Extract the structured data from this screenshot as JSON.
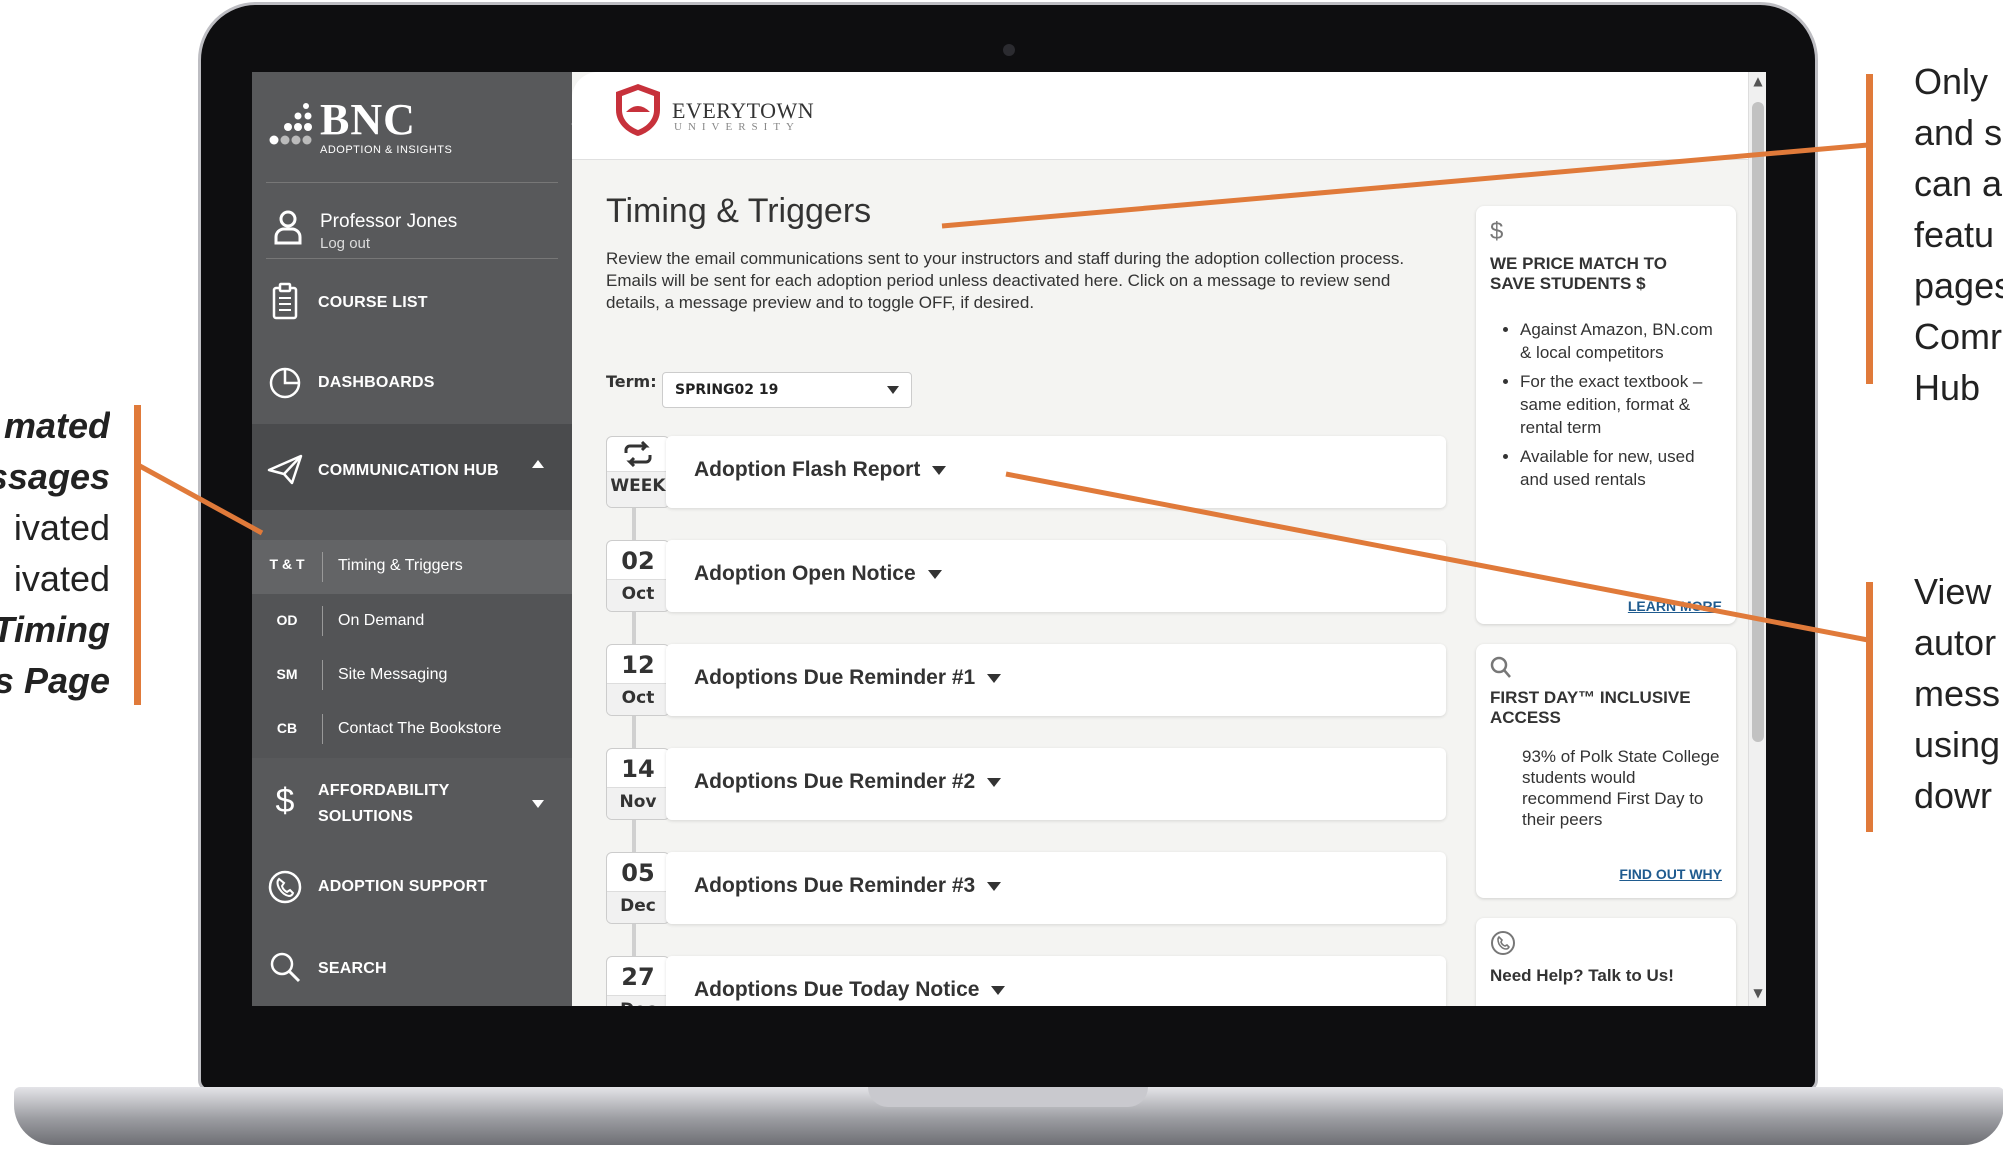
{
  "sidebar": {
    "logo_text": "BNC",
    "logo_sub": "ADOPTION & INSIGHTS",
    "collapse_icon": "chevron-left-icon",
    "user_name": "Professor Jones",
    "logout": "Log out",
    "nav": [
      {
        "label": "COURSE LIST",
        "icon": "clipboard-icon"
      },
      {
        "label": "DASHBOARDS",
        "icon": "pie-chart-icon"
      },
      {
        "label": "COMMUNICATION HUB",
        "icon": "paper-plane-icon",
        "expanded": true
      },
      {
        "label": "AFFORDABILITY",
        "label2": "SOLUTIONS",
        "icon": "dollar-icon"
      },
      {
        "label": "ADOPTION SUPPORT",
        "icon": "phone-icon"
      },
      {
        "label": "SEARCH",
        "icon": "search-icon"
      }
    ],
    "subnav": [
      {
        "abbr": "T & T",
        "label": "Timing & Triggers",
        "active": true
      },
      {
        "abbr": "OD",
        "label": "On Demand"
      },
      {
        "abbr": "SM",
        "label": "Site Messaging"
      },
      {
        "abbr": "CB",
        "label": "Contact The Bookstore"
      }
    ]
  },
  "header": {
    "school": "EVERYTOWN",
    "school_sub": "UNIVERSITY"
  },
  "main": {
    "title": "Timing & Triggers",
    "description": "Review the email communications sent to your instructors and staff during the adoption collection process. Emails will be sent for each adoption period unless deactivated here. Click on a message to review send details, a message preview and to toggle OFF, if desired.",
    "term_label": "Term:",
    "term_value": "SPRING02 19",
    "triggers": [
      {
        "day": "",
        "month": "WEEK",
        "name": "Adoption Flash Report",
        "repeat": true
      },
      {
        "day": "02",
        "month": "Oct",
        "name": "Adoption Open Notice"
      },
      {
        "day": "12",
        "month": "Oct",
        "name": "Adoptions Due Reminder #1"
      },
      {
        "day": "14",
        "month": "Nov",
        "name": "Adoptions Due Reminder #2"
      },
      {
        "day": "05",
        "month": "Dec",
        "name": "Adoptions Due Reminder #3"
      },
      {
        "day": "27",
        "month": "Dec",
        "name": "Adoptions Due Today Notice"
      }
    ]
  },
  "side_cards": [
    {
      "icon": "dollar-icon",
      "title": "WE PRICE MATCH TO SAVE STUDENTS $",
      "bullets": [
        "Against Amazon, BN.com & local competitors",
        "For the exact textbook – same edition, format & rental term",
        "Available for new, used and used rentals"
      ],
      "link": "LEARN MORE"
    },
    {
      "icon": "search-icon",
      "title": "FIRST DAY™ INCLUSIVE ACCESS",
      "body": "93% of Polk State College students would recommend First Day to their peers",
      "link": "FIND OUT WHY"
    },
    {
      "icon": "phone-icon",
      "title": "Need Help? Talk to Us!"
    }
  ],
  "annotations": {
    "left": [
      "mated",
      "ssages",
      "ivated",
      "ivated",
      "Timing",
      "s Page"
    ],
    "right_top": [
      "Only",
      "and s",
      "can a",
      "featu",
      "pages",
      "Comr",
      "Hub"
    ],
    "right_bottom": [
      "View",
      "autor",
      "mess",
      "using",
      "dowr"
    ],
    "accent_color": "#e07a3a"
  }
}
